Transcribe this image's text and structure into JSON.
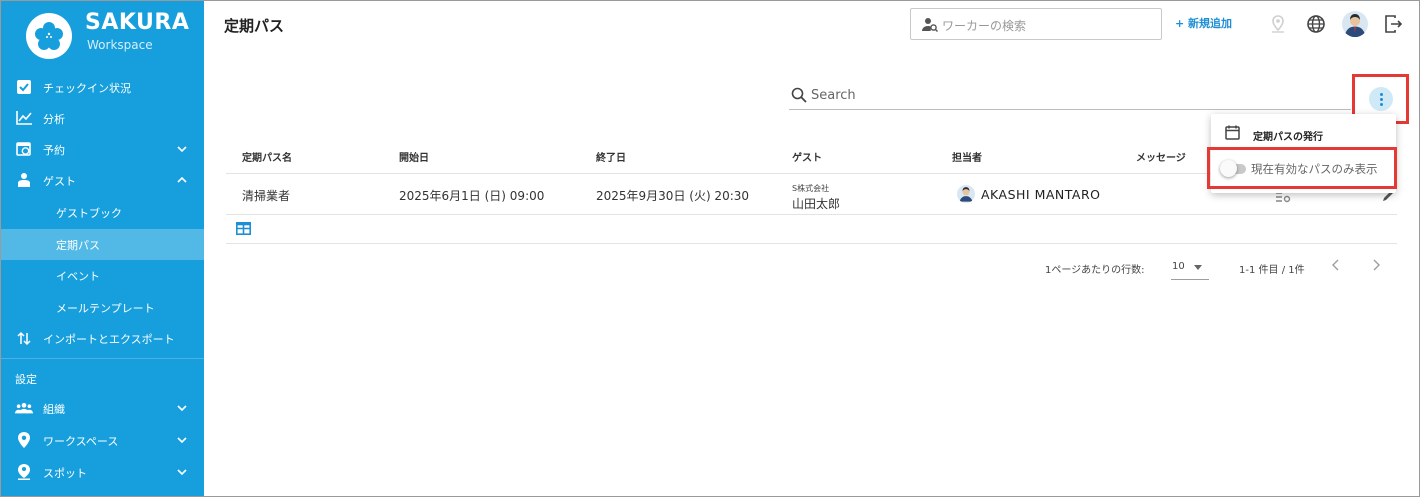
{
  "brand": {
    "name": "SAKURA",
    "sub": "Workspace"
  },
  "sidebar": {
    "items": [
      {
        "label": "チェックイン状況"
      },
      {
        "label": "分析"
      },
      {
        "label": "予約"
      },
      {
        "label": "ゲスト"
      },
      {
        "label": "ゲストブック"
      },
      {
        "label": "定期パス"
      },
      {
        "label": "イベント"
      },
      {
        "label": "メールテンプレート"
      },
      {
        "label": "インポートとエクスポート"
      },
      {
        "label": "組織"
      },
      {
        "label": "ワークスペース"
      },
      {
        "label": "スポット"
      }
    ],
    "settings_label": "設定",
    "active_item": "定期パス"
  },
  "header": {
    "title": "定期パス",
    "worker_search_placeholder": "ワーカーの検索",
    "new_label": "+ 新規追加"
  },
  "search": {
    "placeholder": "Search"
  },
  "table": {
    "columns": [
      "定期パス名",
      "開始日",
      "終了日",
      "ゲスト",
      "担当者",
      "メッセージ"
    ],
    "rows": [
      {
        "name": "清掃業者",
        "start": "2025年6月1日 (日) 09:00",
        "end": "2025年9月30日 (火) 20:30",
        "guest_company": "S株式会社",
        "guest_name": "山田太郎",
        "staff": "AKASHI MANTARO"
      }
    ]
  },
  "pagination": {
    "rows_per_page_label": "1ページあたりの行数:",
    "rows_per_page": "10",
    "range": "1-1 件目 / 1件"
  },
  "menu": {
    "issue_label": "定期パスの発行",
    "active_only_label": "現在有効なパスのみ表示",
    "active_only_on": false
  },
  "colors": {
    "sidebar": "#169fdc",
    "accent": "#1e8fd6",
    "highlight": "#e53935"
  }
}
